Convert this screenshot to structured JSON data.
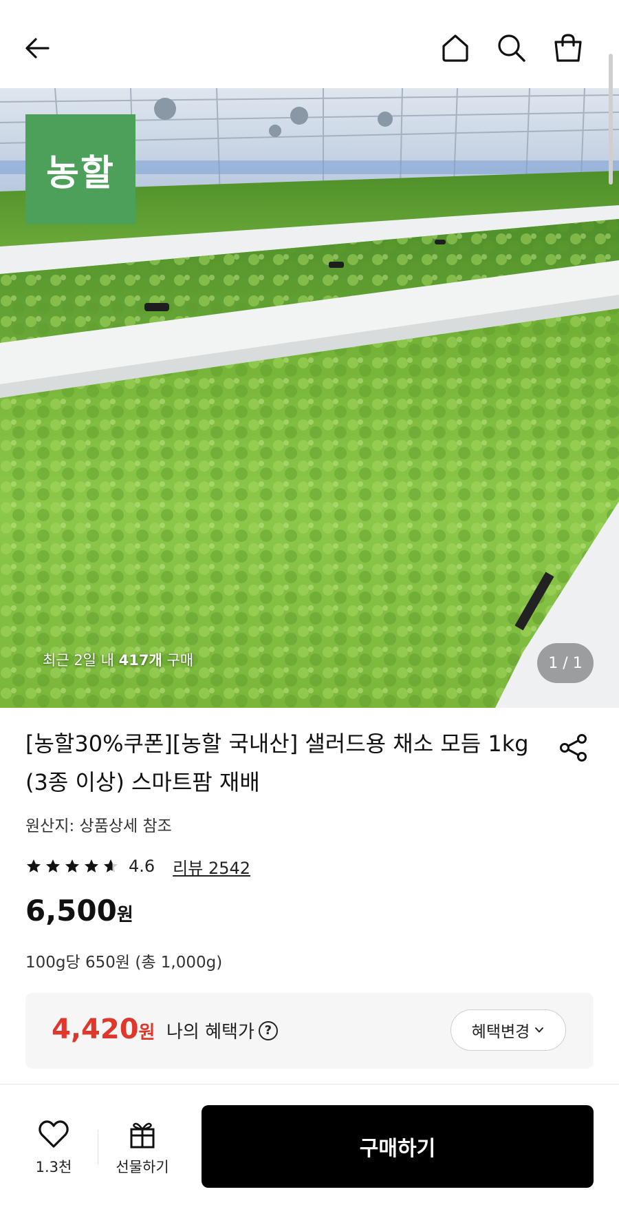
{
  "header": {
    "back_icon": "arrow-left-icon",
    "home_icon": "home-icon",
    "search_icon": "search-icon",
    "cart_icon": "shopping-bag-icon"
  },
  "hero": {
    "brand_logo_text": "농할",
    "recent_prefix": "최근 2일 내 ",
    "recent_count": "417개",
    "recent_suffix": " 구매",
    "pager": "1 / 1"
  },
  "product": {
    "title": "[농할30%쿠폰][농할 국내산] 샐러드용 채소 모듬 1kg (3종 이상) 스마트팜 재배",
    "origin": "원산지: 상품상세 참조",
    "rating_stars": 4.6,
    "rating_text": "4.6",
    "review_label": "리뷰 2542",
    "price": "6,500",
    "price_unit": "원",
    "unit_price": "100g당 650원 (총 1,000g)"
  },
  "benefit": {
    "price": "4,420",
    "price_unit": "원",
    "label": "나의 혜택가",
    "help_icon": "question-circle-icon",
    "change_button": "혜택변경"
  },
  "bottom_bar": {
    "like_count": "1.3천",
    "gift_label": "선물하기",
    "buy_label": "구매하기"
  },
  "colors": {
    "accent_red": "#e0372c",
    "brand_green": "#4da05a",
    "buy_button": "#000000"
  }
}
